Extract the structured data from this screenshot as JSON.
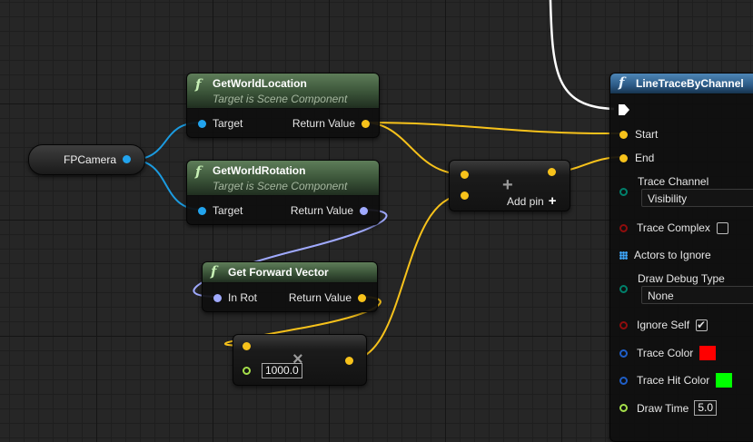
{
  "nodes": {
    "fp_camera": {
      "label": "FPCamera"
    },
    "get_world_location": {
      "title": "GetWorldLocation",
      "subtitle": "Target is Scene Component",
      "input_target": "Target",
      "output_return": "Return Value"
    },
    "get_world_rotation": {
      "title": "GetWorldRotation",
      "subtitle": "Target is Scene Component",
      "input_target": "Target",
      "output_return": "Return Value"
    },
    "get_forward_vector": {
      "title": "Get Forward Vector",
      "input_rot": "In Rot",
      "output_return": "Return Value"
    },
    "add_node": {
      "add_pin_label": "Add pin",
      "symbol": "+"
    },
    "multiply_node": {
      "symbol": "×",
      "value": "1000.0"
    },
    "line_trace": {
      "title": "LineTraceByChannel",
      "start": "Start",
      "end": "End",
      "trace_channel": "Trace Channel",
      "trace_channel_value": "Visibility",
      "trace_complex": "Trace Complex",
      "actors_to_ignore": "Actors to Ignore",
      "draw_debug_type": "Draw Debug Type",
      "draw_debug_value": "None",
      "ignore_self": "Ignore Self",
      "trace_color": "Trace Color",
      "trace_hit_color": "Trace Hit Color",
      "draw_time": "Draw Time",
      "draw_time_value": "5.0"
    }
  },
  "colors": {
    "vector_pin": "#f7c21b",
    "object_pin": "#22a4ee",
    "rotator_pin": "#a0aaff",
    "exec_wire": "#ffffff",
    "trace_color": "#ff0000",
    "trace_hit_color": "#00ff00"
  },
  "icons": {
    "function": "function-f-icon",
    "exec": "exec-pin-icon",
    "array": "array-grid-icon",
    "add": "plus-icon",
    "multiply": "multiply-x-icon"
  }
}
